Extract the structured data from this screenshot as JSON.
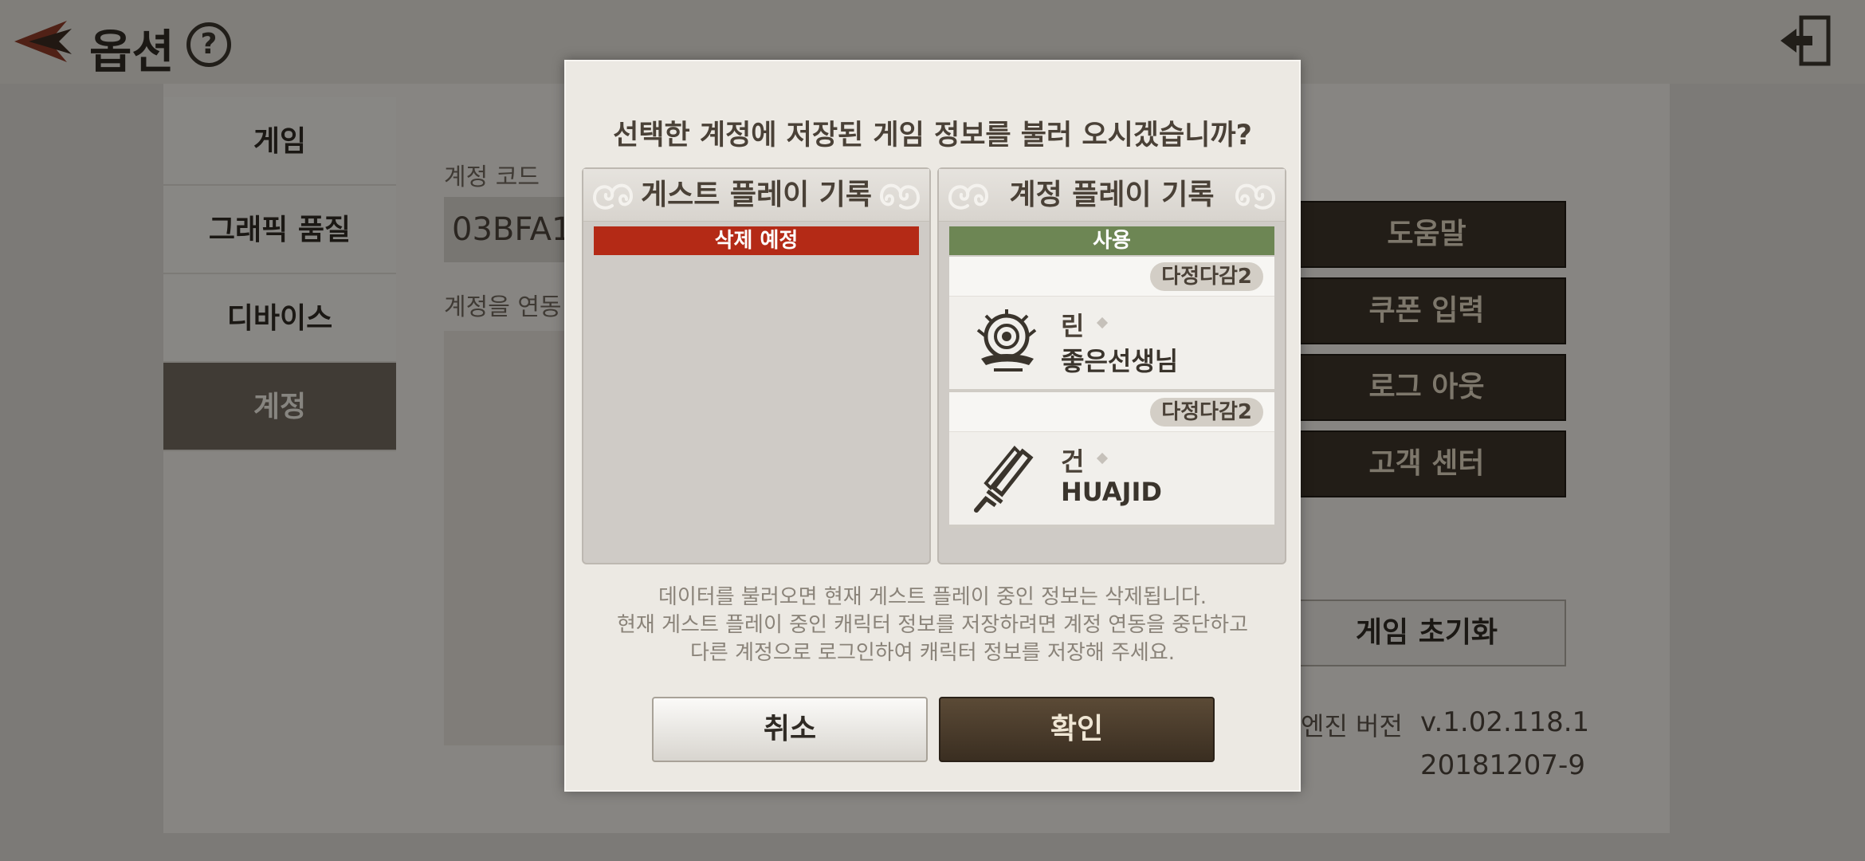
{
  "header": {
    "title": "옵션",
    "help_label": "?"
  },
  "sidebar": {
    "items": [
      {
        "label": "게임"
      },
      {
        "label": "그래픽 품질"
      },
      {
        "label": "디바이스"
      },
      {
        "label": "계정",
        "active": true
      }
    ]
  },
  "account": {
    "code_label": "계정 코드",
    "code_value": "03BFA1",
    "link_label": "계정을 연동"
  },
  "actions": {
    "help": "도움말",
    "coupon": "쿠폰 입력",
    "logout": "로그 아웃",
    "support": "고객 센터",
    "reset": "게임 초기화"
  },
  "engine": {
    "label": "엔진 버전",
    "version": "v.1.02.118.1",
    "build": "20181207-9"
  },
  "dialog": {
    "title": "선택한 계정에 저장된 게임 정보를 불러 오시겠습니까?",
    "guest_panel": {
      "title": "게스트 플레이 기록",
      "status": "삭제 예정"
    },
    "account_panel": {
      "title": "계정 플레이 기록",
      "status": "사용",
      "characters": [
        {
          "tag": "다정다감2",
          "class": "린",
          "name": "좋은선생님",
          "icon": "mandala-fan-icon"
        },
        {
          "tag": "다정다감2",
          "class": "건",
          "name": "HUAJID",
          "icon": "double-blade-icon"
        }
      ]
    },
    "notice": [
      "데이터를 불러오면 현재 게스트 플레이 중인 정보는 삭제됩니다.",
      "현재 게스트 플레이 중인 캐릭터 정보를 저장하려면 계정 연동을 중단하고",
      "다른 계정으로 로그인하여 캐릭터 정보를 저장해 주세요."
    ],
    "cancel_label": "취소",
    "confirm_label": "확인"
  },
  "colors": {
    "status_red": "#b42a16",
    "status_green": "#6d8654",
    "confirm_brown": "#3a2e21",
    "active_nav": "#6e665c"
  }
}
